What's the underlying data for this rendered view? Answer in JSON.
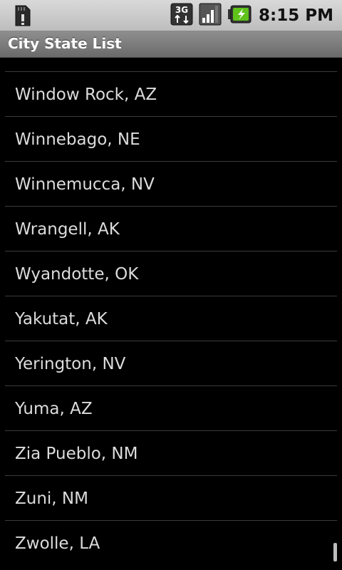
{
  "status_bar": {
    "time": "8:15 PM",
    "network": "3G",
    "icons": [
      "sd-card-icon",
      "3g-data-icon",
      "signal-strength-icon",
      "battery-charging-icon"
    ]
  },
  "title_bar": {
    "title": "City State List"
  },
  "list": {
    "items": [
      "Window Rock, AZ",
      "Winnebago, NE",
      "Winnemucca, NV",
      "Wrangell, AK",
      "Wyandotte, OK",
      "Yakutat, AK",
      "Yerington, NV",
      "Yuma, AZ",
      "Zia Pueblo, NM",
      "Zuni, NM",
      "Zwolle, LA"
    ]
  },
  "colors": {
    "background": "#000000",
    "list_text": "#dcdcdc",
    "divider": "#3b3b3b",
    "title_bar": "#7d7d7d",
    "status_bar": "#cccccc"
  }
}
